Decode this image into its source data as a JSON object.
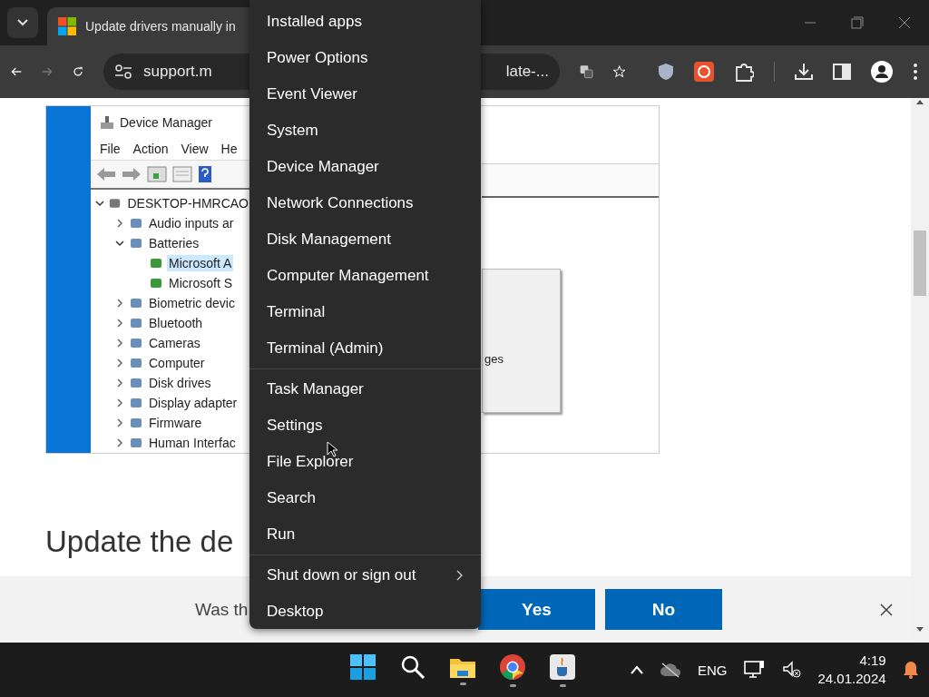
{
  "browser": {
    "tab": {
      "title": "Update drivers manually in"
    },
    "forward_disabled": true,
    "address": {
      "start": "support.m",
      "end": "late-..."
    }
  },
  "article": {
    "figure": {
      "title": "Device Manager",
      "menu": [
        "File",
        "Action",
        "View",
        "He"
      ],
      "tree": [
        {
          "label": "DESKTOP-HMRCAO",
          "expanded": true,
          "selected": false,
          "children": [
            {
              "label": "Audio inputs ar",
              "expanded": false,
              "selected": false
            },
            {
              "label": "Batteries",
              "expanded": true,
              "selected": false,
              "children": [
                {
                  "label": "Microsoft A",
                  "selected": true
                },
                {
                  "label": "Microsoft S",
                  "selected": false
                }
              ]
            },
            {
              "label": "Biometric devic",
              "expanded": false,
              "selected": false
            },
            {
              "label": "Bluetooth",
              "expanded": false,
              "selected": false
            },
            {
              "label": "Cameras",
              "expanded": false,
              "selected": false
            },
            {
              "label": "Computer",
              "expanded": false,
              "selected": false
            },
            {
              "label": "Disk drives",
              "expanded": false,
              "selected": false
            },
            {
              "label": "Display adapter",
              "expanded": false,
              "selected": false
            },
            {
              "label": "Firmware",
              "expanded": false,
              "selected": false
            },
            {
              "label": "Human Interfac",
              "expanded": false,
              "selected": false
            }
          ]
        }
      ],
      "dialog_text": "ges"
    },
    "heading": "Update the de"
  },
  "feedback": {
    "question": "Was th",
    "buttons": [
      "Yes",
      "No"
    ]
  },
  "context_menu": {
    "groups": [
      [
        {
          "label": "Installed apps",
          "submenu": false
        },
        {
          "label": "Power Options",
          "submenu": false
        },
        {
          "label": "Event Viewer",
          "submenu": false
        },
        {
          "label": "System",
          "submenu": false
        },
        {
          "label": "Device Manager",
          "submenu": false
        },
        {
          "label": "Network Connections",
          "submenu": false
        },
        {
          "label": "Disk Management",
          "submenu": false
        },
        {
          "label": "Computer Management",
          "submenu": false
        },
        {
          "label": "Terminal",
          "submenu": false
        },
        {
          "label": "Terminal (Admin)",
          "submenu": false
        }
      ],
      [
        {
          "label": "Task Manager",
          "submenu": false
        },
        {
          "label": "Settings",
          "submenu": false
        },
        {
          "label": "File Explorer",
          "submenu": false
        },
        {
          "label": "Search",
          "submenu": false
        },
        {
          "label": "Run",
          "submenu": false
        }
      ],
      [
        {
          "label": "Shut down or sign out",
          "submenu": true
        },
        {
          "label": "Desktop",
          "submenu": false
        }
      ]
    ]
  },
  "taskbar": {
    "apps": [
      {
        "kind": "start",
        "running": false
      },
      {
        "kind": "search",
        "running": false
      },
      {
        "kind": "files",
        "running": true
      },
      {
        "kind": "browser",
        "running": true
      },
      {
        "kind": "java",
        "running": true
      }
    ],
    "language": "ENG",
    "time": "4:19",
    "date": "24.01.2024"
  }
}
